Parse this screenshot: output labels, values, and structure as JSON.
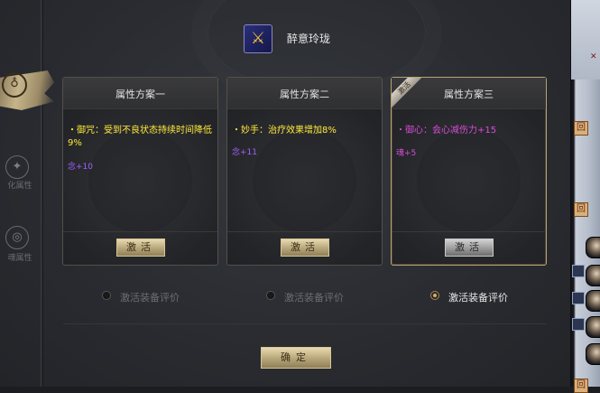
{
  "header": {
    "title": "醉意玲珑",
    "icon": "weapon-icon",
    "icon_color": "#f2c33c"
  },
  "sidebar": {
    "items": [
      {
        "label": "",
        "icon": "brush-tab-icon",
        "active": true
      },
      {
        "label": "化属性",
        "icon": "sparkle-icon"
      },
      {
        "label": "魂属性",
        "icon": "swirl-icon"
      }
    ]
  },
  "cards": [
    {
      "title": "属性方案一",
      "desc": "・御咒：受到不良状态持续时间降低9%",
      "desc_color": "#ffea3a",
      "stat": "念+10",
      "stat_color": "#a060ff",
      "button": "激活",
      "active": false
    },
    {
      "title": "属性方案二",
      "desc": "・妙手：治疗效果增加8%",
      "desc_color": "#ffea3a",
      "stat": "念+11",
      "stat_color": "#a060ff",
      "button": "激活",
      "active": false
    },
    {
      "title": "属性方案三",
      "desc": "・御心：会心减伤力+15",
      "desc_color": "#d84bd8",
      "stat": "魂+5",
      "stat_color": "#d84bd8",
      "button": "激活",
      "active": true,
      "ribbon": "激活"
    }
  ],
  "radios": [
    {
      "label": "激活装备评价",
      "checked": false
    },
    {
      "label": "激活装备评价",
      "checked": false
    },
    {
      "label": "激活装备评价",
      "checked": true
    }
  ],
  "confirm_button": "确定",
  "right_panel": {
    "chars": [
      "回",
      "回",
      "回"
    ]
  },
  "colors": {
    "accent_gold": "#c8b484",
    "panel_bg": "#2a2c31"
  }
}
